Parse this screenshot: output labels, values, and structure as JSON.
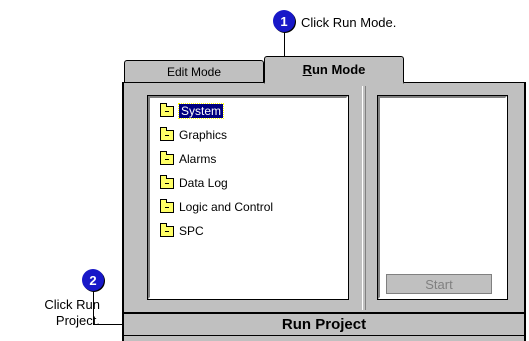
{
  "callouts": [
    {
      "number": "1",
      "text": "Click Run Mode."
    },
    {
      "number": "2",
      "text_line1": "Click Run",
      "text_line2": "Project."
    }
  ],
  "tabs": [
    {
      "label": "Edit Mode",
      "active": false
    },
    {
      "label_prefix": "",
      "label_underlined": "R",
      "label_rest": "un Mode",
      "active": true
    }
  ],
  "tree": {
    "items": [
      {
        "label": "System",
        "selected": true,
        "icon": "folder-icon"
      },
      {
        "label": "Graphics",
        "selected": false,
        "icon": "folder-icon"
      },
      {
        "label": "Alarms",
        "selected": false,
        "icon": "folder-icon"
      },
      {
        "label": "Data Log",
        "selected": false,
        "icon": "folder-icon"
      },
      {
        "label": "Logic and Control",
        "selected": false,
        "icon": "folder-icon"
      },
      {
        "label": "SPC",
        "selected": false,
        "icon": "folder-icon"
      }
    ]
  },
  "start_button": {
    "label": "Start",
    "enabled": false
  },
  "run_project_button": {
    "label": "Run Project"
  },
  "colors": {
    "badge": "#1818c8",
    "window": "#c0c0c0",
    "selection": "#000080"
  }
}
